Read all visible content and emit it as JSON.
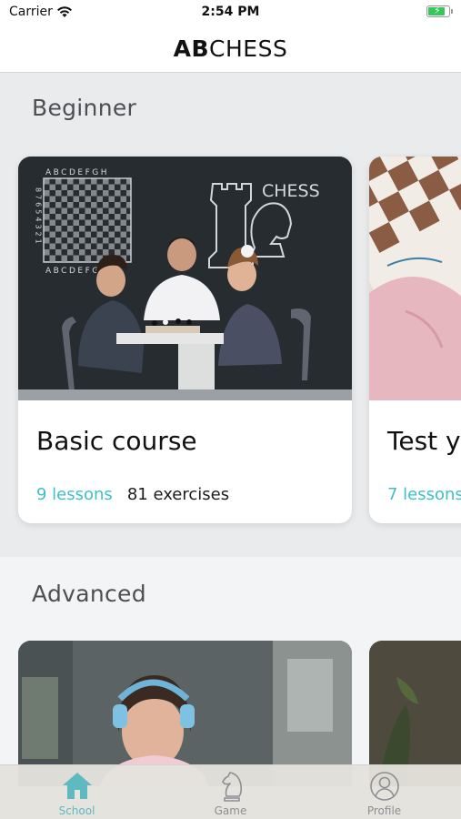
{
  "status_bar": {
    "carrier": "Carrier",
    "time": "2:54 PM"
  },
  "header": {
    "title_bold": "AB",
    "title_regular": "CHESS"
  },
  "sections": {
    "beginner": {
      "title": "Beginner",
      "cards": [
        {
          "title": "Basic course",
          "lessons": "9 lessons",
          "exercises": "81 exercises",
          "image_text": {
            "board_letters_top": "ABCDEFGH",
            "board_letters_bottom": "ABCDEFGH",
            "board_numbers": "87654321",
            "chess_word": "CHESS"
          }
        },
        {
          "title": "Test yo",
          "lessons": "7 lessons"
        }
      ]
    },
    "advanced": {
      "title": "Advanced"
    }
  },
  "tab_bar": {
    "tabs": [
      {
        "label": "School",
        "icon": "home-icon",
        "active": true
      },
      {
        "label": "Game",
        "icon": "chess-knight-icon",
        "active": false
      },
      {
        "label": "Profile",
        "icon": "user-circle-icon",
        "active": false
      }
    ]
  },
  "colors": {
    "accent": "#3fc0c6",
    "tab_active": "#5fb9c0",
    "tab_inactive": "#8e8e93",
    "battery": "#34c759"
  }
}
